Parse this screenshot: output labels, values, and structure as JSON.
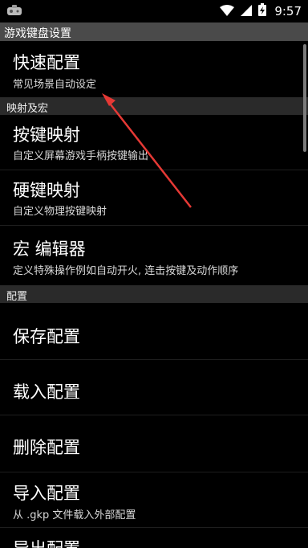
{
  "status_bar": {
    "time": "9:57",
    "icons": [
      "app-notification-icon",
      "wifi-icon",
      "signal-icon",
      "battery-charging-icon"
    ]
  },
  "title_bar": {
    "title": "游戏键盘设置"
  },
  "items": {
    "quick_config": {
      "title": "快速配置",
      "subtitle": "常见场景自动设定"
    },
    "gamepad_mapping": {
      "title": "按键映射",
      "subtitle": "自定义屏幕游戏手柄按键输出"
    },
    "hardware_mapping": {
      "title": "硬键映射",
      "subtitle": "自定义物理按键映射"
    },
    "macro_editor": {
      "title": "宏 编辑器",
      "subtitle": "定义特殊操作例如自动开火, 连击按键及动作顺序"
    },
    "save_config": {
      "title": "保存配置"
    },
    "load_config": {
      "title": "载入配置"
    },
    "delete_config": {
      "title": "删除配置"
    },
    "import_config": {
      "title": "导入配置",
      "subtitle": "从 .gkp 文件载入外部配置"
    },
    "export_config": {
      "title": "导出配置"
    }
  },
  "sections": {
    "mapping_and_macro": "映射及宏",
    "config": "配置"
  },
  "annotation": {
    "color": "#e53935"
  }
}
